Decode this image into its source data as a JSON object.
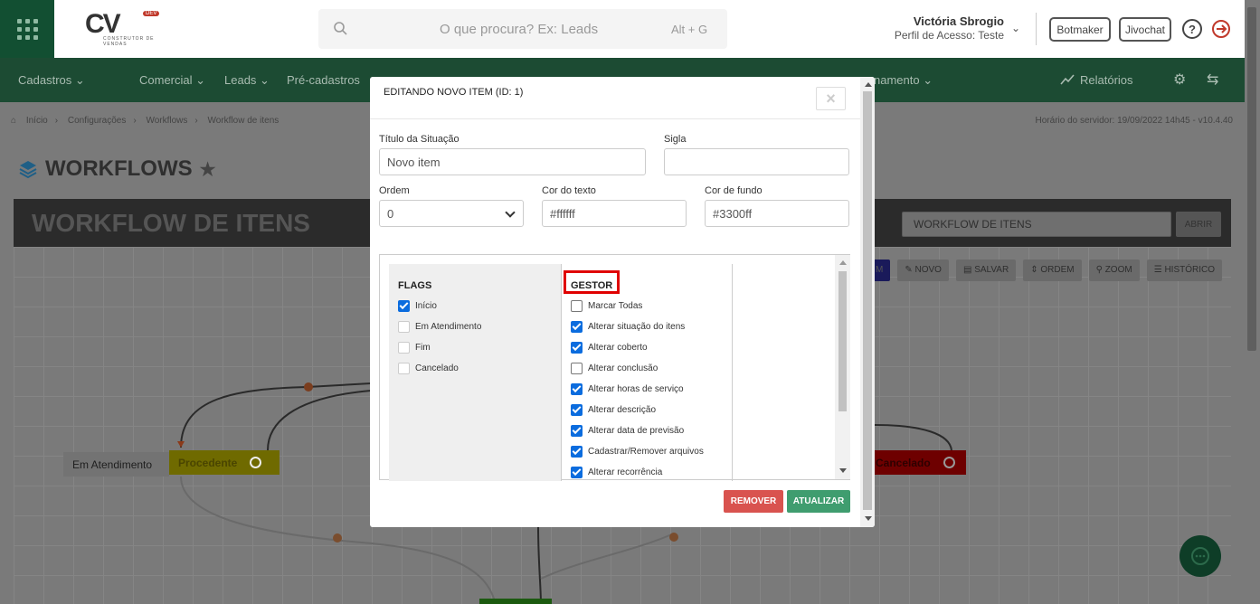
{
  "topbar": {
    "logo_text": "CV",
    "logo_badge": "DEV",
    "logo_subtitle": "CONSTRUTOR DE VENDAS",
    "search_placeholder": "O que procura? Ex: Leads",
    "search_shortcut": "Alt + G",
    "user_name": "Victória Sbrogio",
    "user_role": "Perfil de Acesso: Teste",
    "btn_botmaker": "Botmaker",
    "btn_jivochat": "Jivochat"
  },
  "nav": {
    "items": [
      "Cadastros",
      "Comercial",
      "Leads",
      "Pré-cadastros",
      "namento"
    ],
    "reports": "Relatórios"
  },
  "breadcrumb": [
    "Início",
    "Configurações",
    "Workflows",
    "Workflow de itens"
  ],
  "server_time": "Horário do servidor: 19/09/2022 14h45 - v10.4.40",
  "page": {
    "title": "WORKFLOWS",
    "workflow_title": "WORKFLOW DE ITENS",
    "workflow_select": "WORKFLOW DE ITENS",
    "open_button": "ABRIR",
    "toolbar": [
      "M",
      "NOVO",
      "SALVAR",
      "ORDEM",
      "ZOOM",
      "HISTÓRICO"
    ],
    "nodes": {
      "em_atendimento": "Em Atendimento",
      "procedente": "Procedente",
      "cancelado": "Cancelado"
    }
  },
  "modal": {
    "title": "EDITANDO NOVO ITEM (ID: 1)",
    "close_symbol": "×",
    "fields": {
      "titulo_label": "Título da Situação",
      "titulo_value": "Novo item",
      "sigla_label": "Sigla",
      "sigla_value": "",
      "ordem_label": "Ordem",
      "ordem_value": "0",
      "cor_texto_label": "Cor do texto",
      "cor_texto_value": "#ffffff",
      "cor_fundo_label": "Cor de fundo",
      "cor_fundo_value": "#3300ff"
    },
    "flags": {
      "title": "FLAGS",
      "items": [
        {
          "label": "Início",
          "checked": true
        },
        {
          "label": "Em Atendimento",
          "checked": false
        },
        {
          "label": "Fim",
          "checked": false
        },
        {
          "label": "Cancelado",
          "checked": false
        }
      ]
    },
    "gestor": {
      "title": "GESTOR",
      "items": [
        {
          "label": "Marcar Todas",
          "checked": false
        },
        {
          "label": "Alterar situação do itens",
          "checked": true
        },
        {
          "label": "Alterar coberto",
          "checked": true
        },
        {
          "label": "Alterar conclusão",
          "checked": false
        },
        {
          "label": "Alterar horas de serviço",
          "checked": true
        },
        {
          "label": "Alterar descrição",
          "checked": true
        },
        {
          "label": "Alterar data de previsão",
          "checked": true
        },
        {
          "label": "Cadastrar/Remover arquivos",
          "checked": true
        },
        {
          "label": "Alterar recorrência",
          "checked": true
        }
      ]
    },
    "remove_button": "REMOVER",
    "update_button": "ATUALIZAR"
  },
  "colors": {
    "brand_green": "#1c4b33",
    "checkbox_blue": "#0b6cde",
    "remove_red": "#d9534f",
    "update_green": "#3f9d6f",
    "highlight_red": "#e00000"
  }
}
